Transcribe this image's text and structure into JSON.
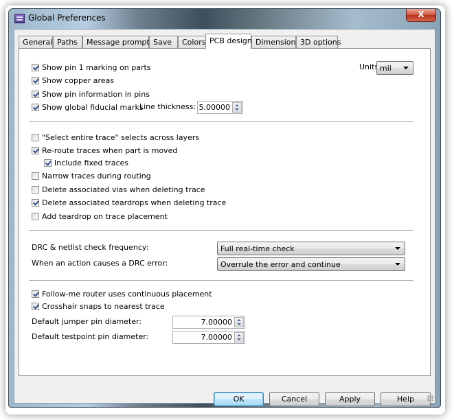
{
  "window": {
    "title": "Global Preferences",
    "close_label": "X"
  },
  "tabs": [
    {
      "label": "General"
    },
    {
      "label": "Paths"
    },
    {
      "label": "Message prompts"
    },
    {
      "label": "Save"
    },
    {
      "label": "Colors"
    },
    {
      "label": "PCB design",
      "active": true
    },
    {
      "label": "Dimensions"
    },
    {
      "label": "3D options"
    }
  ],
  "display": {
    "show_pin1": {
      "label": "Show pin 1 marking on parts",
      "checked": true
    },
    "show_copper": {
      "label": "Show copper areas",
      "checked": true
    },
    "show_pin_info": {
      "label": "Show pin information in pins",
      "checked": true
    },
    "show_fiducial": {
      "label": "Show global fiducial marks",
      "checked": true
    },
    "line_thickness_label": "Line thickness:",
    "line_thickness_value": "5.00000",
    "units_label": "Units",
    "units_value": "mil"
  },
  "traces": {
    "select_entire": {
      "label": "\"Select entire trace\" selects across layers",
      "checked": false
    },
    "reroute": {
      "label": "Re-route traces when part is moved",
      "checked": true
    },
    "include_fixed": {
      "label": "Include fixed traces",
      "checked": true
    },
    "narrow": {
      "label": "Narrow traces during routing",
      "checked": false
    },
    "delete_vias": {
      "label": "Delete associated vias when deleting trace",
      "checked": false
    },
    "delete_teardrops": {
      "label": "Delete associated teardrops when deleting trace",
      "checked": true
    },
    "add_teardrop": {
      "label": "Add teardrop on trace placement",
      "checked": false
    }
  },
  "drc": {
    "frequency_label": "DRC & netlist check frequency:",
    "frequency_value": "Full real-time check",
    "error_label": "When an action causes a DRC error:",
    "error_value": "Overrule the error and continue"
  },
  "router": {
    "follow_me": {
      "label": "Follow-me router uses continuous placement",
      "checked": true
    },
    "crosshair": {
      "label": "Crosshair snaps to nearest trace",
      "checked": true
    },
    "jumper_label": "Default jumper pin diameter:",
    "jumper_value": "7.00000",
    "testpoint_label": "Default testpoint pin diameter:",
    "testpoint_value": "7.00000"
  },
  "buttons": {
    "ok": "OK",
    "cancel": "Cancel",
    "apply": "Apply",
    "help": "Help"
  }
}
